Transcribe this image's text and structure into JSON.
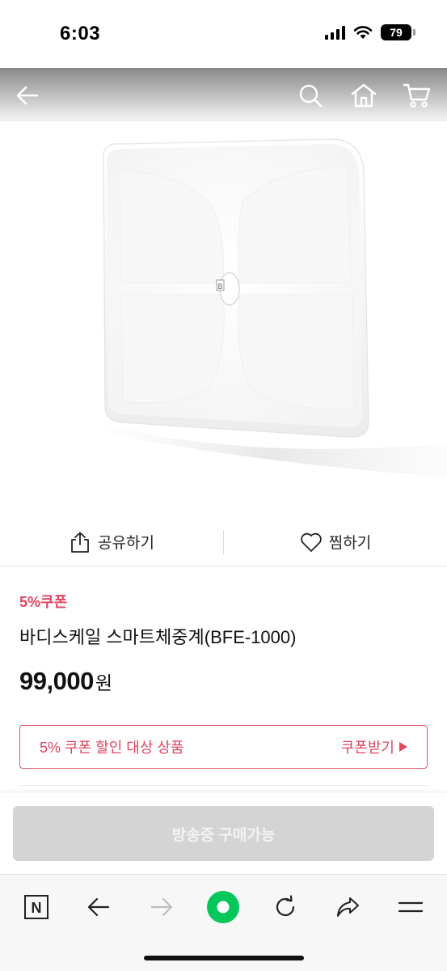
{
  "status_bar": {
    "time": "6:03",
    "battery": "79"
  },
  "nav": {
    "icons": [
      "back-arrow-icon",
      "search-icon",
      "home-icon",
      "cart-icon"
    ]
  },
  "actions": {
    "share_label": "공유하기",
    "wish_label": "찜하기"
  },
  "product": {
    "coupon_tag": "5%쿠폰",
    "title": "바디스케일 스마트체중계(BFE-1000)",
    "price": "99,000",
    "price_unit": "원",
    "scale_brand_mark": "B"
  },
  "coupon_banner": {
    "text": "5% 쿠폰 할인 대상 상품",
    "link_label": "쿠폰받기"
  },
  "buy": {
    "button_label": "방송중 구매가능"
  },
  "browser_toolbar": {
    "icons": [
      "naver-icon",
      "back-icon",
      "forward-icon",
      "green-dot-icon",
      "reload-icon",
      "share-icon",
      "menu-icon"
    ],
    "naver_letter": "N"
  },
  "colors": {
    "accent": "#e0445f",
    "green": "#03c75a",
    "disabled_button": "#d4d4d4"
  }
}
